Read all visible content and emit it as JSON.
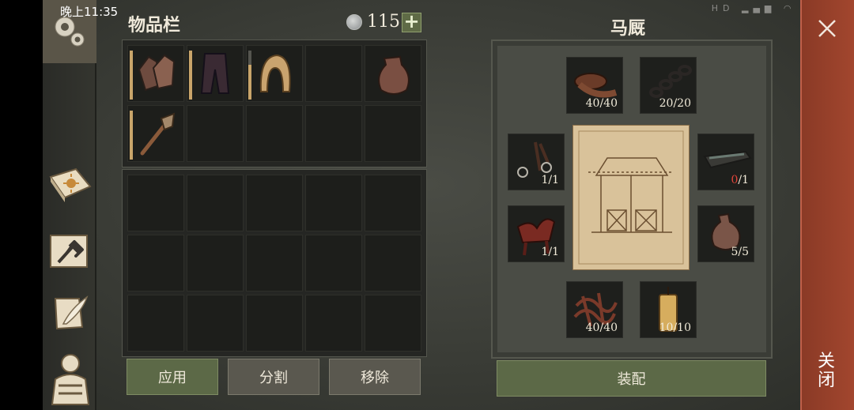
{
  "status_bar": {
    "time": "晚上11:35",
    "icons": [
      "hd-icon",
      "signal-icon",
      "wifi-icon",
      "battery-icon"
    ]
  },
  "inventory": {
    "title": "物品栏",
    "currency": 115,
    "plus_label": "+",
    "items": [
      {
        "name": "gloves-icon",
        "durability_bar": "full"
      },
      {
        "name": "trousers-icon",
        "durability_bar": "full"
      },
      {
        "name": "hood-icon",
        "durability_bar": "partial"
      },
      {
        "name": "empty"
      },
      {
        "name": "pouch-icon"
      },
      {
        "name": "torch-icon",
        "durability_bar": "full"
      }
    ]
  },
  "buttons": {
    "apply": "应用",
    "split": "分割",
    "remove": "移除",
    "assemble": "装配"
  },
  "stable": {
    "title": "马厩",
    "ingredients": [
      {
        "name": "leather-roll-icon",
        "count": "40/40"
      },
      {
        "name": "chain-icon",
        "count": "20/20"
      },
      {
        "name": "bridle-icon",
        "count": "1/1"
      },
      {
        "name": "trough-icon",
        "count_have": "0",
        "count_need": "/1"
      },
      {
        "name": "saddle-icon",
        "count": "1/1"
      },
      {
        "name": "sack-icon",
        "count": "5/5"
      },
      {
        "name": "rope-bundle-icon",
        "count": "40/40"
      },
      {
        "name": "candle-icon",
        "count": "10/10"
      }
    ]
  },
  "close": {
    "label_top": "关",
    "label_bottom": "闭"
  },
  "colors": {
    "accent_green": "#5c6947",
    "close_red": "#a2462e",
    "missing_red": "#e2453a"
  }
}
